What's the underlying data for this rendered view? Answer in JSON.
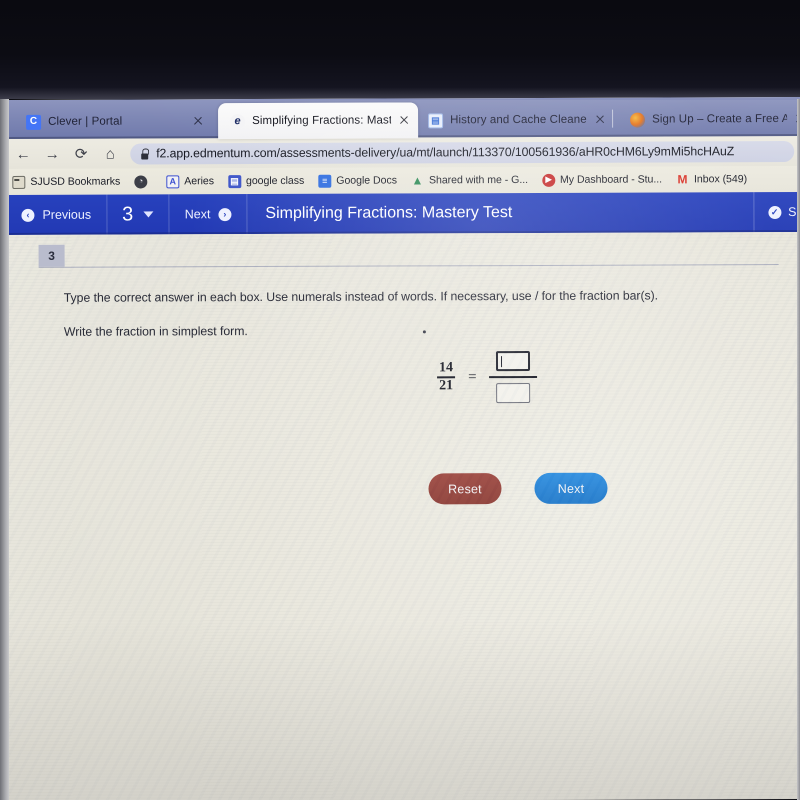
{
  "browser": {
    "tabs": [
      {
        "title": "Clever | Portal",
        "favicon": "clever-icon",
        "favicon_glyph": "C",
        "active": false
      },
      {
        "title": "Simplifying Fractions: Maste",
        "favicon": "edmentum-icon",
        "favicon_glyph": "e",
        "active": true
      },
      {
        "title": "History and Cache Cleaner",
        "favicon": "history-cleaner-icon",
        "favicon_glyph": "▤",
        "active": false
      },
      {
        "title": "Sign Up – Create a Free Acc",
        "favicon": "signup-icon",
        "favicon_glyph": "",
        "active": false
      }
    ],
    "nav": {
      "back": "←",
      "forward": "→",
      "reload": "⟳",
      "home": "⌂"
    },
    "omnibox": {
      "lock_icon": "lock-icon",
      "url": "f2.app.edmentum.com/assessments-delivery/ua/mt/launch/113370/100561936/aHR0cHM6Ly9mMi5hcHAuZ",
      "placeholder": "Search Google or type a URL"
    },
    "bookmarks": [
      {
        "label": "SJUSD Bookmarks",
        "icon": "folder-icon",
        "glyph": ""
      },
      {
        "label": "",
        "icon": "globe-icon",
        "glyph": "◔"
      },
      {
        "label": "Aeries",
        "icon": "aeries-icon",
        "glyph": "A"
      },
      {
        "label": "google class",
        "icon": "google-classroom-icon",
        "glyph": "▤"
      },
      {
        "label": "Google Docs",
        "icon": "google-docs-icon",
        "glyph": "≡"
      },
      {
        "label": "Shared with me - G...",
        "icon": "google-drive-icon",
        "glyph": "▲"
      },
      {
        "label": "My Dashboard - Stu...",
        "icon": "dashboard-icon",
        "glyph": "▶"
      },
      {
        "label": "Inbox (549)",
        "icon": "gmail-icon",
        "glyph": "M"
      }
    ]
  },
  "appbar": {
    "previous_label": "Previous",
    "previous_icon": "arrow-left-circle-icon",
    "question_number": "3",
    "dropdown_icon": "chevron-down-icon",
    "next_label": "Next",
    "next_icon": "arrow-right-circle-icon",
    "title": "Simplifying Fractions: Mastery Test",
    "submit_icon": "check-circle-icon",
    "submit_label": "S",
    "bg_color": "#2239b4"
  },
  "question": {
    "number": "3",
    "instruction": "Type the correct answer in each box. Use numerals instead of words. If necessary, use / for the fraction bar(s).",
    "prompt": "Write the fraction in simplest form.",
    "fraction": {
      "numerator": "14",
      "denominator": "21",
      "equals": "=",
      "answer_numerator": "",
      "answer_denominator": ""
    }
  },
  "actions": {
    "reset_label": "Reset",
    "reset_color": "#8e3f38",
    "next_label": "Next",
    "next_color": "#2179ca"
  }
}
